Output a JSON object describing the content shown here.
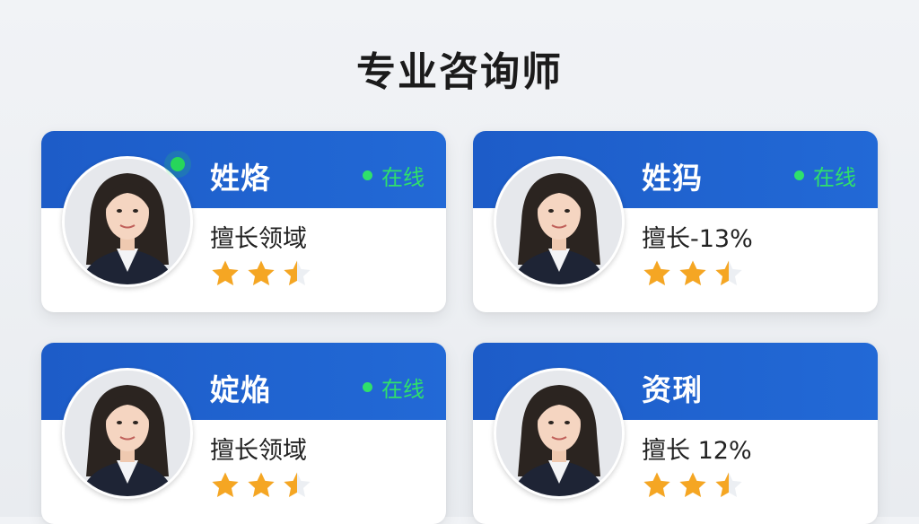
{
  "page": {
    "title": "专业咨询师"
  },
  "cards": [
    {
      "name": "姓烙",
      "status": "在线",
      "specialty": "擅长领域",
      "rating": 2.5
    },
    {
      "name": "姓犸",
      "status": "在线",
      "specialty": "擅长-13%",
      "rating": 2.5
    },
    {
      "name": "婝焔",
      "status": "在线",
      "specialty": "擅长领域",
      "rating": 2.5
    },
    {
      "name": "资琍",
      "status": "",
      "specialty": "擅长 12%",
      "rating": 2.5
    }
  ],
  "colors": {
    "header_blue": "#1d5cc8",
    "online_green": "#2fe06b",
    "star_gold": "#f5a623"
  }
}
